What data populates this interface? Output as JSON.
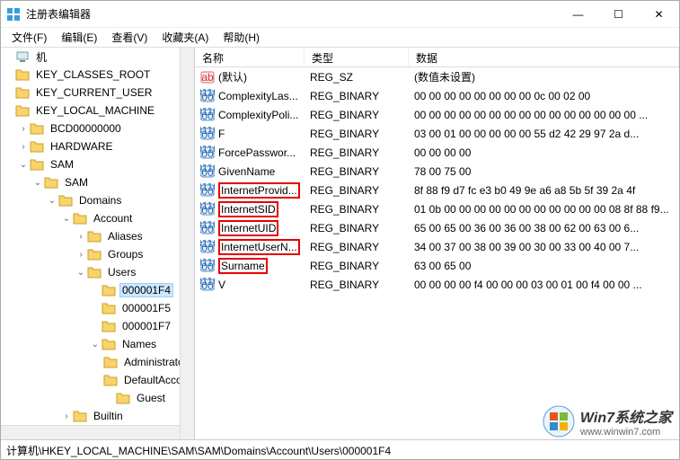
{
  "window": {
    "title": "注册表编辑器",
    "minimize": "—",
    "maximize": "☐",
    "close": "✕"
  },
  "menu": {
    "file": "文件(F)",
    "edit": "编辑(E)",
    "view": "查看(V)",
    "favorites": "收藏夹(A)",
    "help": "帮助(H)"
  },
  "tree": {
    "root": "机",
    "nodes": [
      {
        "label": "KEY_CLASSES_ROOT",
        "depth": 0,
        "exp": ""
      },
      {
        "label": "KEY_CURRENT_USER",
        "depth": 0,
        "exp": ""
      },
      {
        "label": "KEY_LOCAL_MACHINE",
        "depth": 0,
        "exp": ""
      },
      {
        "label": "BCD00000000",
        "depth": 1,
        "exp": ">"
      },
      {
        "label": "HARDWARE",
        "depth": 1,
        "exp": ">"
      },
      {
        "label": "SAM",
        "depth": 1,
        "exp": "v"
      },
      {
        "label": "SAM",
        "depth": 2,
        "exp": "v"
      },
      {
        "label": "Domains",
        "depth": 3,
        "exp": "v"
      },
      {
        "label": "Account",
        "depth": 4,
        "exp": "v"
      },
      {
        "label": "Aliases",
        "depth": 5,
        "exp": ">"
      },
      {
        "label": "Groups",
        "depth": 5,
        "exp": ">"
      },
      {
        "label": "Users",
        "depth": 5,
        "exp": "v"
      },
      {
        "label": "000001F4",
        "depth": 6,
        "exp": "",
        "selected": true
      },
      {
        "label": "000001F5",
        "depth": 6,
        "exp": ""
      },
      {
        "label": "000001F7",
        "depth": 6,
        "exp": ""
      },
      {
        "label": "Names",
        "depth": 6,
        "exp": "v"
      },
      {
        "label": "Administrator",
        "depth": 7,
        "exp": ""
      },
      {
        "label": "DefaultAccount",
        "depth": 7,
        "exp": ""
      },
      {
        "label": "Guest",
        "depth": 7,
        "exp": ""
      },
      {
        "label": "Builtin",
        "depth": 4,
        "exp": ">"
      }
    ]
  },
  "columns": {
    "name": "名称",
    "type": "类型",
    "data": "数据"
  },
  "values": [
    {
      "icon": "str",
      "name": "(默认)",
      "type": "REG_SZ",
      "data": "(数值未设置)",
      "highlight": false
    },
    {
      "icon": "bin",
      "name": "ComplexityLas...",
      "type": "REG_BINARY",
      "data": "00 00 00 00 00 00 00 00 0c 00 02 00",
      "highlight": false
    },
    {
      "icon": "bin",
      "name": "ComplexityPoli...",
      "type": "REG_BINARY",
      "data": "00 00 00 00 00 00 00 00 00 00 00 00 00 00 00 ...",
      "highlight": false
    },
    {
      "icon": "bin",
      "name": "F",
      "type": "REG_BINARY",
      "data": "03 00 01 00 00 00 00 00 55 d2 42 29 97 2a d...",
      "highlight": false
    },
    {
      "icon": "bin",
      "name": "ForcePasswor...",
      "type": "REG_BINARY",
      "data": "00 00 00 00",
      "highlight": false
    },
    {
      "icon": "bin",
      "name": "GivenName",
      "type": "REG_BINARY",
      "data": "78 00 75 00",
      "highlight": false
    },
    {
      "icon": "bin",
      "name": "InternetProvid...",
      "type": "REG_BINARY",
      "data": "8f 88 f9 d7 fc e3 b0 49 9e a6 a8 5b 5f 39 2a 4f",
      "highlight": true
    },
    {
      "icon": "bin",
      "name": "InternetSID",
      "type": "REG_BINARY",
      "data": "01 0b 00 00 00 00 00 00 00 00 00 00 00 08 8f 88 f9...",
      "highlight": true
    },
    {
      "icon": "bin",
      "name": "InternetUID",
      "type": "REG_BINARY",
      "data": "65 00 65 00 36 00 36 00 38 00 62 00 63 00 6...",
      "highlight": true
    },
    {
      "icon": "bin",
      "name": "InternetUserN...",
      "type": "REG_BINARY",
      "data": "34 00 37 00 38 00 39 00 30 00 33 00 40 00 7...",
      "highlight": true
    },
    {
      "icon": "bin",
      "name": "Surname",
      "type": "REG_BINARY",
      "data": "63 00 65 00",
      "highlight": true
    },
    {
      "icon": "bin",
      "name": "V",
      "type": "REG_BINARY",
      "data": "00 00 00 00 f4 00 00 00 03 00 01 00 f4 00 00 ...",
      "highlight": false
    }
  ],
  "status": "计算机\\HKEY_LOCAL_MACHINE\\SAM\\SAM\\Domains\\Account\\Users\\000001F4",
  "watermark": {
    "line1": "Win7系统之家",
    "line2": "www.winwin7.com"
  }
}
